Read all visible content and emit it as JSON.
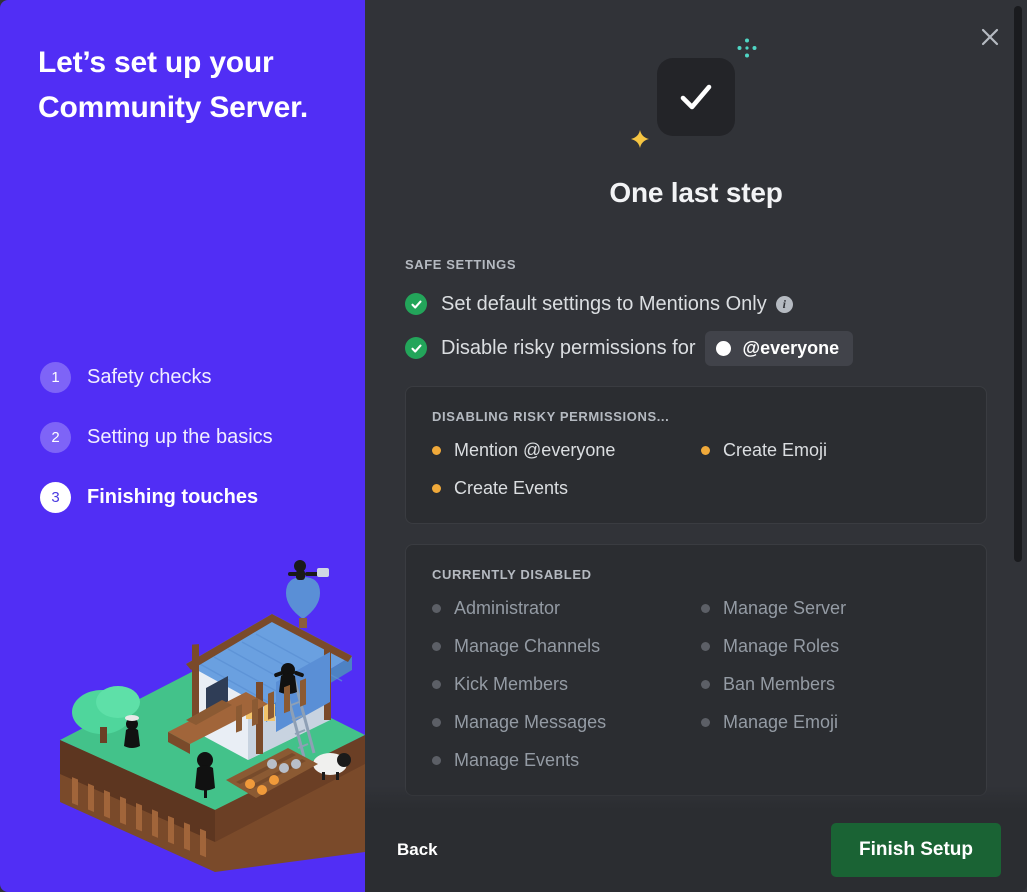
{
  "window": {
    "accent_purple": "#512EF5",
    "panel_bg": "#313338",
    "card_bg": "#2B2D31",
    "success_green": "#23A55A",
    "warn_amber": "#F0A93A",
    "finish_green": "#1A6334"
  },
  "sidebar": {
    "heading": "Let’s set up your Community Server.",
    "steps": [
      {
        "number": "1",
        "label": "Safety checks",
        "active": false
      },
      {
        "number": "2",
        "label": "Setting up the basics",
        "active": false
      },
      {
        "number": "3",
        "label": "Finishing touches",
        "active": true
      }
    ],
    "illustration_name": "isometric-farmhouse-illustration"
  },
  "main": {
    "close_icon": "close-icon",
    "hero_icon": "checkmark-icon",
    "sparkle_teal": "sparkle-dots-icon",
    "sparkle_yellow": "four-point-star-icon",
    "title": "One last step",
    "safe_settings": {
      "label": "SAFE SETTINGS",
      "rows": [
        {
          "text": "Set default settings to Mentions Only",
          "has_info": true,
          "info_glyph": "i"
        },
        {
          "text": "Disable risky permissions for",
          "has_info": false,
          "role_pill": {
            "name": "@everyone",
            "dot_color": "#FFFFFF"
          }
        }
      ]
    },
    "disabling_panel": {
      "title": "DISABLING RISKY PERMISSIONS...",
      "items": [
        "Mention @everyone",
        "Create Emoji",
        "Create Events"
      ]
    },
    "currently_disabled_panel": {
      "title": "CURRENTLY DISABLED",
      "items": [
        "Administrator",
        "Manage Server",
        "Manage Channels",
        "Manage Roles",
        "Kick Members",
        "Ban Members",
        "Manage Messages",
        "Manage Emoji",
        "Manage Events"
      ]
    },
    "scrollbar": {
      "name": "vertical-scrollbar"
    }
  },
  "footer": {
    "back_label": "Back",
    "finish_label": "Finish Setup"
  }
}
